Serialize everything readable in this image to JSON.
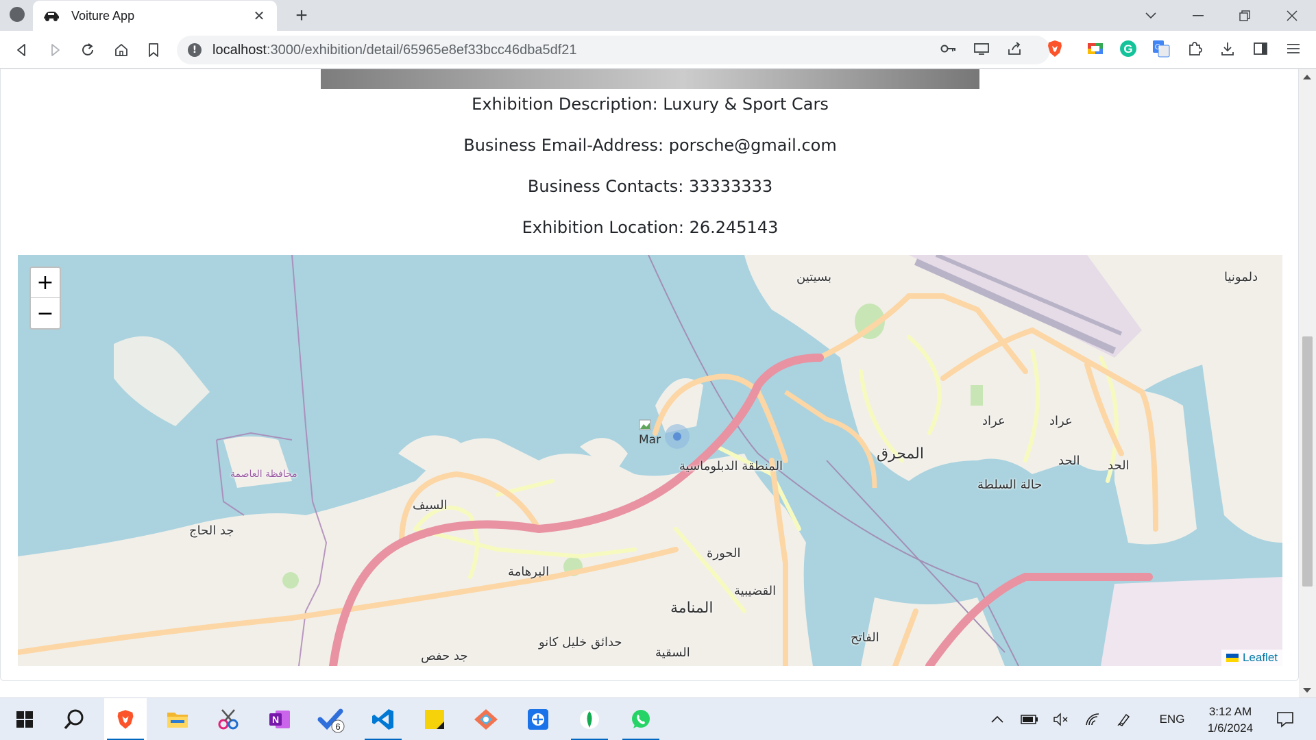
{
  "browser": {
    "tab_title": "Voiture App",
    "url_host": "localhost",
    "url_rest": ":3000/exhibition/detail/65965e8ef33bcc46dba5df21"
  },
  "exhibition": {
    "description": "Exhibition Description: Luxury & Sport Cars",
    "email": "Business Email-Address: porsche@gmail.com",
    "contacts": "Business Contacts: 33333333",
    "location": "Exhibition Location: 26.245143"
  },
  "map": {
    "zoom_in": "+",
    "zoom_out": "−",
    "attribution": "Leaflet",
    "marker_alt": "Mar",
    "places": {
      "seef": "السيف",
      "jidhafs": "جد حفص",
      "jidalhaj": "جد الحاج",
      "burhama": "البرهامة",
      "manama": "المنامة",
      "hoora": "الحورة",
      "qudaibiya": "القضيبية",
      "diplomatic": "المنطقة الدبلوماسية",
      "muharraq": "المحرق",
      "busaiteen": "بسيتين",
      "arad": "عراد",
      "arad2": "عراد",
      "hidd": "الحد",
      "hidd2": "الحد",
      "halat": "حالة السلطة",
      "dilmunia": "دلمونيا",
      "fateh": "الفاتح",
      "gudaibiya": "السقية",
      "kano": "حدائق خليل كانو",
      "capital": "محافظة العاصمة"
    }
  },
  "taskbar": {
    "language": "ENG",
    "time": "3:12 AM",
    "date": "1/6/2024",
    "todo_badge": "6"
  },
  "colors": {
    "water": "#aad3df",
    "land": "#f2efe9",
    "motorway": "#e892a2",
    "primary_road": "#fcd6a4",
    "secondary_road": "#f7fabf"
  }
}
